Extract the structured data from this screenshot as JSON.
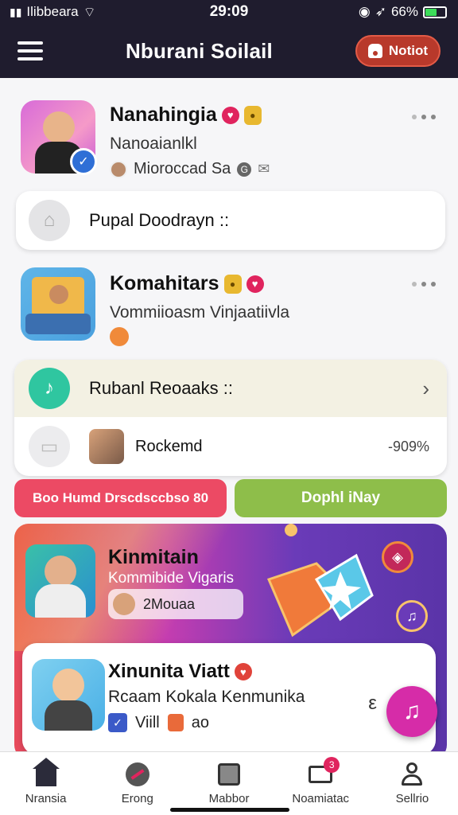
{
  "status_bar": {
    "carrier": "Ilibbeara",
    "time": "29:09",
    "battery": "66%"
  },
  "header": {
    "title": "Nburani Soilail",
    "action_label": "Notiot"
  },
  "feed": {
    "item1": {
      "title": "Nanahingia",
      "subtitle": "Nanoaianlkl",
      "meta": "Mioroccad Sa"
    },
    "card1": {
      "label": "Pupal Doodrayn ::"
    },
    "item2": {
      "title": "Komahitars",
      "subtitle": "Vommiioasm Vinjaatiivla"
    },
    "card2": {
      "header_label": "Rubanl Reoaaks ::",
      "row_label": "Rockemd",
      "row_value": "-909%"
    }
  },
  "buttons": {
    "left_label": "Boo Humd Drscdsccbso 80",
    "right_label": "Dophl iNay"
  },
  "banner": {
    "title": "Kinmitain",
    "subtitle": "Kommibide Vigaris",
    "chip_label": "2Mouaa"
  },
  "featured": {
    "title": "Xinunita Viatt",
    "subtitle": "Rcaam Kokala Kenmunika",
    "meta": "Viill",
    "meta_extra": "ao",
    "side_mark": "ε"
  },
  "bottom_nav": [
    {
      "label": "Nransia",
      "icon": "home-icon"
    },
    {
      "label": "Erong",
      "icon": "compass-icon"
    },
    {
      "label": "Mabbor",
      "icon": "box-icon"
    },
    {
      "label": "Noamiatac",
      "icon": "mail-icon",
      "badge": "3"
    },
    {
      "label": "Sellrio",
      "icon": "profile-icon"
    }
  ],
  "colors": {
    "header_bg": "#1f1c2e",
    "accent_red": "#b8392b",
    "teal": "#2fc6a0",
    "pink_button": "#ec4a64",
    "green_button": "#8ebe4a",
    "fab": "#d62ca8"
  }
}
